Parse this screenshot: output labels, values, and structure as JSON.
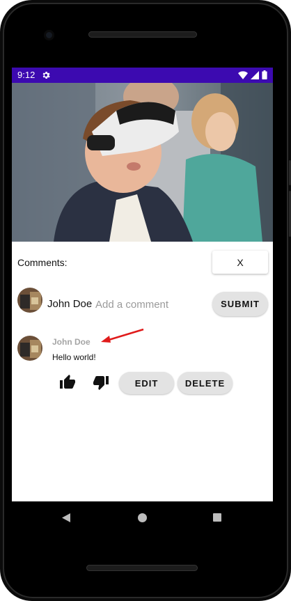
{
  "status_bar": {
    "time": "9:12",
    "icons": [
      "gear-icon",
      "wifi-icon",
      "signal-icon",
      "battery-icon"
    ],
    "color": "#3c0ab0"
  },
  "hero_image": {
    "description_icon": "vr-headset-photo"
  },
  "comments_header": {
    "label": "Comments:",
    "close_label": "X"
  },
  "composer": {
    "user_name": "John Doe",
    "placeholder": "Add a comment",
    "submit_label": "SUBMIT"
  },
  "comments": [
    {
      "author": "John Doe",
      "text": "Hello world!",
      "edit_label": "EDIT",
      "delete_label": "DELETE"
    }
  ],
  "annotation": {
    "arrow_color": "#e01b1b"
  },
  "nav": {
    "icons": [
      "back-icon",
      "home-icon",
      "recents-icon"
    ]
  }
}
